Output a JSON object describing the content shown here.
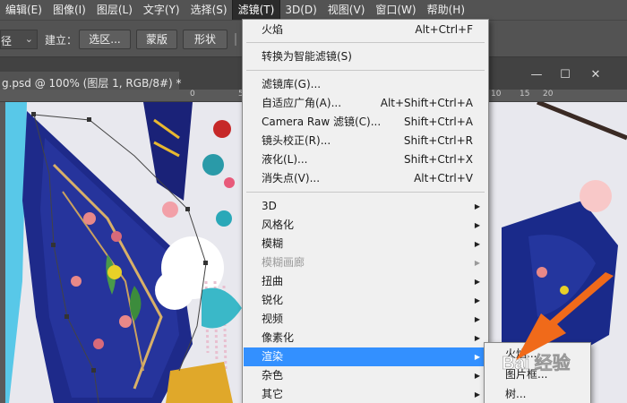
{
  "menubar": {
    "items": [
      {
        "label": "编辑(E)"
      },
      {
        "label": "图像(I)"
      },
      {
        "label": "图层(L)"
      },
      {
        "label": "文字(Y)"
      },
      {
        "label": "选择(S)"
      },
      {
        "label": "滤镜(T)"
      },
      {
        "label": "3D(D)"
      },
      {
        "label": "视图(V)"
      },
      {
        "label": "窗口(W)"
      },
      {
        "label": "帮助(H)"
      }
    ]
  },
  "options": {
    "select_value": "径",
    "make_label": "建立：",
    "selection_btn": "选区...",
    "mask_btn": "蒙版",
    "shape_btn": "形状"
  },
  "document": {
    "tab_title": "g.psd @ 100% (图层 1, RGB/8#) *",
    "ruler_ticks": [
      "0",
      "5",
      "10",
      "15",
      "20"
    ]
  },
  "filter_menu": {
    "items": [
      {
        "label": "火焰",
        "shortcut": "Alt+Ctrl+F"
      },
      {
        "label": "转换为智能滤镜(S)",
        "shortcut": ""
      },
      {
        "label": "滤镜库(G)...",
        "shortcut": ""
      },
      {
        "label": "自适应广角(A)...",
        "shortcut": "Alt+Shift+Ctrl+A"
      },
      {
        "label": "Camera Raw 滤镜(C)...",
        "shortcut": "Shift+Ctrl+A"
      },
      {
        "label": "镜头校正(R)...",
        "shortcut": "Shift+Ctrl+R"
      },
      {
        "label": "液化(L)...",
        "shortcut": "Shift+Ctrl+X"
      },
      {
        "label": "消失点(V)...",
        "shortcut": "Alt+Ctrl+V"
      },
      {
        "label": "3D"
      },
      {
        "label": "风格化"
      },
      {
        "label": "模糊"
      },
      {
        "label": "模糊画廊"
      },
      {
        "label": "扭曲"
      },
      {
        "label": "锐化"
      },
      {
        "label": "视频"
      },
      {
        "label": "像素化"
      },
      {
        "label": "渲染"
      },
      {
        "label": "杂色"
      },
      {
        "label": "其它"
      }
    ]
  },
  "render_submenu": {
    "items": [
      {
        "label": "火焰..."
      },
      {
        "label": "图片框..."
      },
      {
        "label": "树..."
      }
    ]
  },
  "watermark": {
    "text": "Bai 经验"
  },
  "colors": {
    "highlight": "#3390ff",
    "arrow": "#f06a1a",
    "menubar": "#535353"
  }
}
